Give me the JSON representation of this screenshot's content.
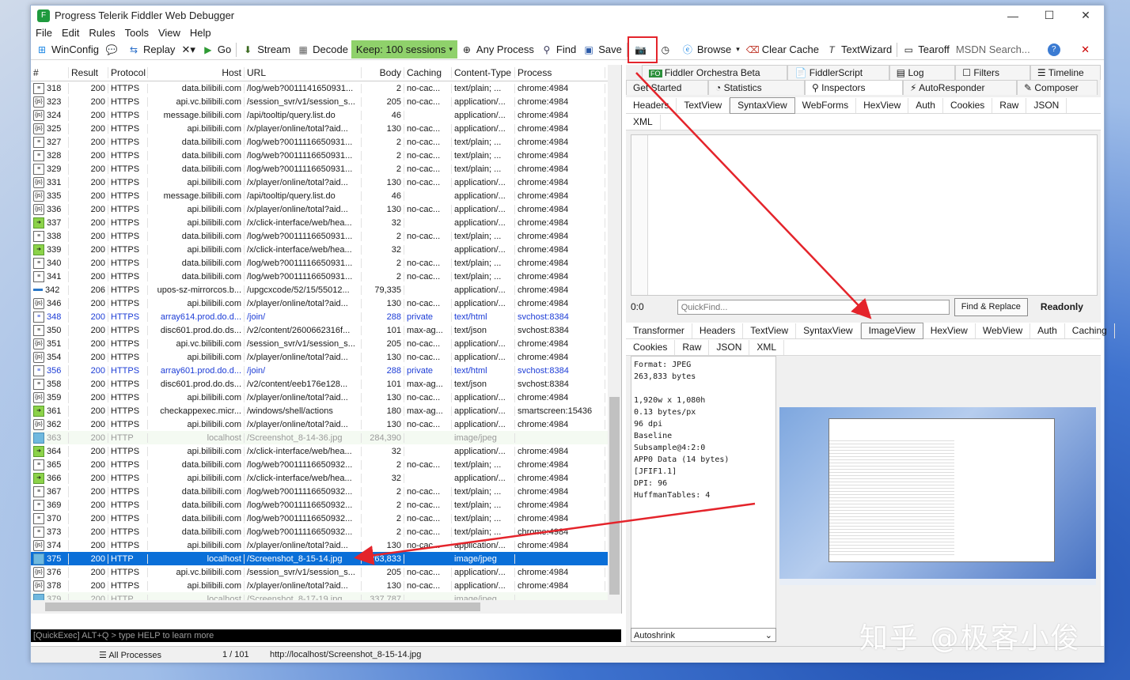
{
  "window": {
    "title": "Progress Telerik Fiddler Web Debugger",
    "minimize": "—",
    "maximize": "☐",
    "close": "✕"
  },
  "menu": [
    "File",
    "Edit",
    "Rules",
    "Tools",
    "View",
    "Help"
  ],
  "toolbar": {
    "winconfig": "WinConfig",
    "replay": "Replay",
    "remove": "✕▾",
    "go": "Go",
    "stream": "Stream",
    "decode": "Decode",
    "keep": "Keep: 100 sessions",
    "any_process": "Any Process",
    "find": "Find",
    "save": "Save",
    "browse": "Browse",
    "clear_cache": "Clear Cache",
    "textwizard": "TextWizard",
    "tearoff": "Tearoff",
    "msdn": "MSDN Search..."
  },
  "grid": {
    "headers": [
      "#",
      "Result",
      "Protocol",
      "Host",
      "URL",
      "Body",
      "Caching",
      "Content-Type",
      "Process"
    ],
    "rows": [
      {
        "icon": "doc",
        "id": "318",
        "result": "200",
        "protocol": "HTTPS",
        "host": "data.bilibili.com",
        "url": "/log/web?0011141650931...",
        "body": "2",
        "caching": "no-cac...",
        "ctype": "text/plain; ...",
        "process": "chrome:4984",
        "style": ""
      },
      {
        "icon": "js",
        "id": "323",
        "result": "200",
        "protocol": "HTTPS",
        "host": "api.vc.bilibili.com",
        "url": "/session_svr/v1/session_s...",
        "body": "205",
        "caching": "no-cac...",
        "ctype": "application/...",
        "process": "chrome:4984",
        "style": ""
      },
      {
        "icon": "js",
        "id": "324",
        "result": "200",
        "protocol": "HTTPS",
        "host": "message.bilibili.com",
        "url": "/api/tooltip/query.list.do",
        "body": "46",
        "caching": "",
        "ctype": "application/...",
        "process": "chrome:4984",
        "style": ""
      },
      {
        "icon": "js",
        "id": "325",
        "result": "200",
        "protocol": "HTTPS",
        "host": "api.bilibili.com",
        "url": "/x/player/online/total?aid...",
        "body": "130",
        "caching": "no-cac...",
        "ctype": "application/...",
        "process": "chrome:4984",
        "style": ""
      },
      {
        "icon": "doc",
        "id": "327",
        "result": "200",
        "protocol": "HTTPS",
        "host": "data.bilibili.com",
        "url": "/log/web?0011116650931...",
        "body": "2",
        "caching": "no-cac...",
        "ctype": "text/plain; ...",
        "process": "chrome:4984",
        "style": ""
      },
      {
        "icon": "doc",
        "id": "328",
        "result": "200",
        "protocol": "HTTPS",
        "host": "data.bilibili.com",
        "url": "/log/web?0011116650931...",
        "body": "2",
        "caching": "no-cac...",
        "ctype": "text/plain; ...",
        "process": "chrome:4984",
        "style": ""
      },
      {
        "icon": "doc",
        "id": "329",
        "result": "200",
        "protocol": "HTTPS",
        "host": "data.bilibili.com",
        "url": "/log/web?0011116650931...",
        "body": "2",
        "caching": "no-cac...",
        "ctype": "text/plain; ...",
        "process": "chrome:4984",
        "style": ""
      },
      {
        "icon": "js",
        "id": "331",
        "result": "200",
        "protocol": "HTTPS",
        "host": "api.bilibili.com",
        "url": "/x/player/online/total?aid...",
        "body": "130",
        "caching": "no-cac...",
        "ctype": "application/...",
        "process": "chrome:4984",
        "style": ""
      },
      {
        "icon": "js",
        "id": "335",
        "result": "200",
        "protocol": "HTTPS",
        "host": "message.bilibili.com",
        "url": "/api/tooltip/query.list.do",
        "body": "46",
        "caching": "",
        "ctype": "application/...",
        "process": "chrome:4984",
        "style": ""
      },
      {
        "icon": "js",
        "id": "336",
        "result": "200",
        "protocol": "HTTPS",
        "host": "api.bilibili.com",
        "url": "/x/player/online/total?aid...",
        "body": "130",
        "caching": "no-cac...",
        "ctype": "application/...",
        "process": "chrome:4984",
        "style": ""
      },
      {
        "icon": "post",
        "id": "337",
        "result": "200",
        "protocol": "HTTPS",
        "host": "api.bilibili.com",
        "url": "/x/click-interface/web/hea...",
        "body": "32",
        "caching": "",
        "ctype": "application/...",
        "process": "chrome:4984",
        "style": ""
      },
      {
        "icon": "doc",
        "id": "338",
        "result": "200",
        "protocol": "HTTPS",
        "host": "data.bilibili.com",
        "url": "/log/web?0011116650931...",
        "body": "2",
        "caching": "no-cac...",
        "ctype": "text/plain; ...",
        "process": "chrome:4984",
        "style": ""
      },
      {
        "icon": "post",
        "id": "339",
        "result": "200",
        "protocol": "HTTPS",
        "host": "api.bilibili.com",
        "url": "/x/click-interface/web/hea...",
        "body": "32",
        "caching": "",
        "ctype": "application/...",
        "process": "chrome:4984",
        "style": ""
      },
      {
        "icon": "doc",
        "id": "340",
        "result": "200",
        "protocol": "HTTPS",
        "host": "data.bilibili.com",
        "url": "/log/web?0011116650931...",
        "body": "2",
        "caching": "no-cac...",
        "ctype": "text/plain; ...",
        "process": "chrome:4984",
        "style": ""
      },
      {
        "icon": "doc",
        "id": "341",
        "result": "200",
        "protocol": "HTTPS",
        "host": "data.bilibili.com",
        "url": "/log/web?0011116650931...",
        "body": "2",
        "caching": "no-cac...",
        "ctype": "text/plain; ...",
        "process": "chrome:4984",
        "style": ""
      },
      {
        "icon": "bar",
        "id": "342",
        "result": "206",
        "protocol": "HTTPS",
        "host": "upos-sz-mirrorcos.b...",
        "url": "/upgcxcode/52/15/55012...",
        "body": "79,335",
        "caching": "",
        "ctype": "application/...",
        "process": "chrome:4984",
        "style": ""
      },
      {
        "icon": "js",
        "id": "346",
        "result": "200",
        "protocol": "HTTPS",
        "host": "api.bilibili.com",
        "url": "/x/player/online/total?aid...",
        "body": "130",
        "caching": "no-cac...",
        "ctype": "application/...",
        "process": "chrome:4984",
        "style": ""
      },
      {
        "icon": "doc",
        "id": "348",
        "result": "200",
        "protocol": "HTTPS",
        "host": "array614.prod.do.d...",
        "url": "/join/",
        "body": "288",
        "caching": "private",
        "ctype": "text/html",
        "process": "svchost:8384",
        "style": "blue"
      },
      {
        "icon": "doc",
        "id": "350",
        "result": "200",
        "protocol": "HTTPS",
        "host": "disc601.prod.do.ds...",
        "url": "/v2/content/2600662316f...",
        "body": "101",
        "caching": "max-ag...",
        "ctype": "text/json",
        "process": "svchost:8384",
        "style": ""
      },
      {
        "icon": "js",
        "id": "351",
        "result": "200",
        "protocol": "HTTPS",
        "host": "api.vc.bilibili.com",
        "url": "/session_svr/v1/session_s...",
        "body": "205",
        "caching": "no-cac...",
        "ctype": "application/...",
        "process": "chrome:4984",
        "style": ""
      },
      {
        "icon": "js",
        "id": "354",
        "result": "200",
        "protocol": "HTTPS",
        "host": "api.bilibili.com",
        "url": "/x/player/online/total?aid...",
        "body": "130",
        "caching": "no-cac...",
        "ctype": "application/...",
        "process": "chrome:4984",
        "style": ""
      },
      {
        "icon": "doc",
        "id": "356",
        "result": "200",
        "protocol": "HTTPS",
        "host": "array601.prod.do.d...",
        "url": "/join/",
        "body": "288",
        "caching": "private",
        "ctype": "text/html",
        "process": "svchost:8384",
        "style": "blue"
      },
      {
        "icon": "doc",
        "id": "358",
        "result": "200",
        "protocol": "HTTPS",
        "host": "disc601.prod.do.ds...",
        "url": "/v2/content/eeb176e128...",
        "body": "101",
        "caching": "max-ag...",
        "ctype": "text/json",
        "process": "svchost:8384",
        "style": ""
      },
      {
        "icon": "js",
        "id": "359",
        "result": "200",
        "protocol": "HTTPS",
        "host": "api.bilibili.com",
        "url": "/x/player/online/total?aid...",
        "body": "130",
        "caching": "no-cac...",
        "ctype": "application/...",
        "process": "chrome:4984",
        "style": ""
      },
      {
        "icon": "post",
        "id": "361",
        "result": "200",
        "protocol": "HTTPS",
        "host": "checkappexec.micr...",
        "url": "/windows/shell/actions",
        "body": "180",
        "caching": "max-ag...",
        "ctype": "application/...",
        "process": "smartscreen:15436",
        "style": ""
      },
      {
        "icon": "js",
        "id": "362",
        "result": "200",
        "protocol": "HTTPS",
        "host": "api.bilibili.com",
        "url": "/x/player/online/total?aid...",
        "body": "130",
        "caching": "no-cac...",
        "ctype": "application/...",
        "process": "chrome:4984",
        "style": ""
      },
      {
        "icon": "img",
        "id": "363",
        "result": "200",
        "protocol": "HTTP",
        "host": "localhost",
        "url": "/Screenshot_8-14-36.jpg",
        "body": "284,390",
        "caching": "",
        "ctype": "image/jpeg",
        "process": "",
        "style": "dim"
      },
      {
        "icon": "post",
        "id": "364",
        "result": "200",
        "protocol": "HTTPS",
        "host": "api.bilibili.com",
        "url": "/x/click-interface/web/hea...",
        "body": "32",
        "caching": "",
        "ctype": "application/...",
        "process": "chrome:4984",
        "style": ""
      },
      {
        "icon": "doc",
        "id": "365",
        "result": "200",
        "protocol": "HTTPS",
        "host": "data.bilibili.com",
        "url": "/log/web?0011116650932...",
        "body": "2",
        "caching": "no-cac...",
        "ctype": "text/plain; ...",
        "process": "chrome:4984",
        "style": ""
      },
      {
        "icon": "post",
        "id": "366",
        "result": "200",
        "protocol": "HTTPS",
        "host": "api.bilibili.com",
        "url": "/x/click-interface/web/hea...",
        "body": "32",
        "caching": "",
        "ctype": "application/...",
        "process": "chrome:4984",
        "style": ""
      },
      {
        "icon": "doc",
        "id": "367",
        "result": "200",
        "protocol": "HTTPS",
        "host": "data.bilibili.com",
        "url": "/log/web?0011116650932...",
        "body": "2",
        "caching": "no-cac...",
        "ctype": "text/plain; ...",
        "process": "chrome:4984",
        "style": ""
      },
      {
        "icon": "doc",
        "id": "369",
        "result": "200",
        "protocol": "HTTPS",
        "host": "data.bilibili.com",
        "url": "/log/web?0011116650932...",
        "body": "2",
        "caching": "no-cac...",
        "ctype": "text/plain; ...",
        "process": "chrome:4984",
        "style": ""
      },
      {
        "icon": "doc",
        "id": "370",
        "result": "200",
        "protocol": "HTTPS",
        "host": "data.bilibili.com",
        "url": "/log/web?0011116650932...",
        "body": "2",
        "caching": "no-cac...",
        "ctype": "text/plain; ...",
        "process": "chrome:4984",
        "style": ""
      },
      {
        "icon": "doc",
        "id": "373",
        "result": "200",
        "protocol": "HTTPS",
        "host": "data.bilibili.com",
        "url": "/log/web?0011116650932...",
        "body": "2",
        "caching": "no-cac...",
        "ctype": "text/plain; ...",
        "process": "chrome:4984",
        "style": ""
      },
      {
        "icon": "js",
        "id": "374",
        "result": "200",
        "protocol": "HTTPS",
        "host": "api.bilibili.com",
        "url": "/x/player/online/total?aid...",
        "body": "130",
        "caching": "no-cac...",
        "ctype": "application/...",
        "process": "chrome:4984",
        "style": ""
      },
      {
        "icon": "img",
        "id": "375",
        "result": "200",
        "protocol": "HTTP",
        "host": "localhost",
        "url": "/Screenshot_8-15-14.jpg",
        "body": "263,833",
        "caching": "",
        "ctype": "image/jpeg",
        "process": "",
        "style": "sel"
      },
      {
        "icon": "js",
        "id": "376",
        "result": "200",
        "protocol": "HTTPS",
        "host": "api.vc.bilibili.com",
        "url": "/session_svr/v1/session_s...",
        "body": "205",
        "caching": "no-cac...",
        "ctype": "application/...",
        "process": "chrome:4984",
        "style": ""
      },
      {
        "icon": "js",
        "id": "378",
        "result": "200",
        "protocol": "HTTPS",
        "host": "api.bilibili.com",
        "url": "/x/player/online/total?aid...",
        "body": "130",
        "caching": "no-cac...",
        "ctype": "application/...",
        "process": "chrome:4984",
        "style": ""
      },
      {
        "icon": "img",
        "id": "379",
        "result": "200",
        "protocol": "HTTP",
        "host": "localhost",
        "url": "/Screenshot_8-17-19.jpg",
        "body": "337,787",
        "caching": "",
        "ctype": "image/jpeg",
        "process": "",
        "style": "dim"
      }
    ]
  },
  "quickexec": "[QuickExec] ALT+Q > type HELP to learn more",
  "status": {
    "processes": "All Processes",
    "count": "1 / 101",
    "url": "http://localhost/Screenshot_8-15-14.jpg"
  },
  "right": {
    "top_tabs_1": [
      "Fiddler Orchestra Beta",
      "FiddlerScript",
      "Log",
      "Filters",
      "Timeline"
    ],
    "top_tabs_2": [
      "Get Started",
      "Statistics",
      "Inspectors",
      "AutoResponder",
      "Composer"
    ],
    "req_tabs": [
      "Headers",
      "TextView",
      "SyntaxView",
      "WebForms",
      "HexView",
      "Auth",
      "Cookies",
      "Raw",
      "JSON"
    ],
    "req_tabs_2": [
      "XML"
    ],
    "position": "0:0",
    "quickfind_placeholder": "QuickFind...",
    "find_replace": "Find & Replace",
    "readonly": "Readonly",
    "resp_tabs": [
      "Transformer",
      "Headers",
      "TextView",
      "SyntaxView",
      "ImageView",
      "HexView",
      "WebView",
      "Auth",
      "Caching"
    ],
    "resp_tabs_2": [
      "Cookies",
      "Raw",
      "JSON",
      "XML"
    ],
    "image_info": "Format: JPEG\n263,833 bytes\n\n1,920w x 1,080h\n0.13 bytes/px\n96 dpi\nBaseline\nSubsample@4:2:0\nAPP0 Data (14 bytes)\n[JFIF1.1]\nDPI: 96\nHuffmanTables: 4",
    "autoshrink": "Autoshrink"
  },
  "watermark": "知乎 @极客小俊",
  "colors": {
    "keep_bg": "#8fd16b",
    "selected_row": "#0a6fd8",
    "annotation": "#e4242b"
  }
}
